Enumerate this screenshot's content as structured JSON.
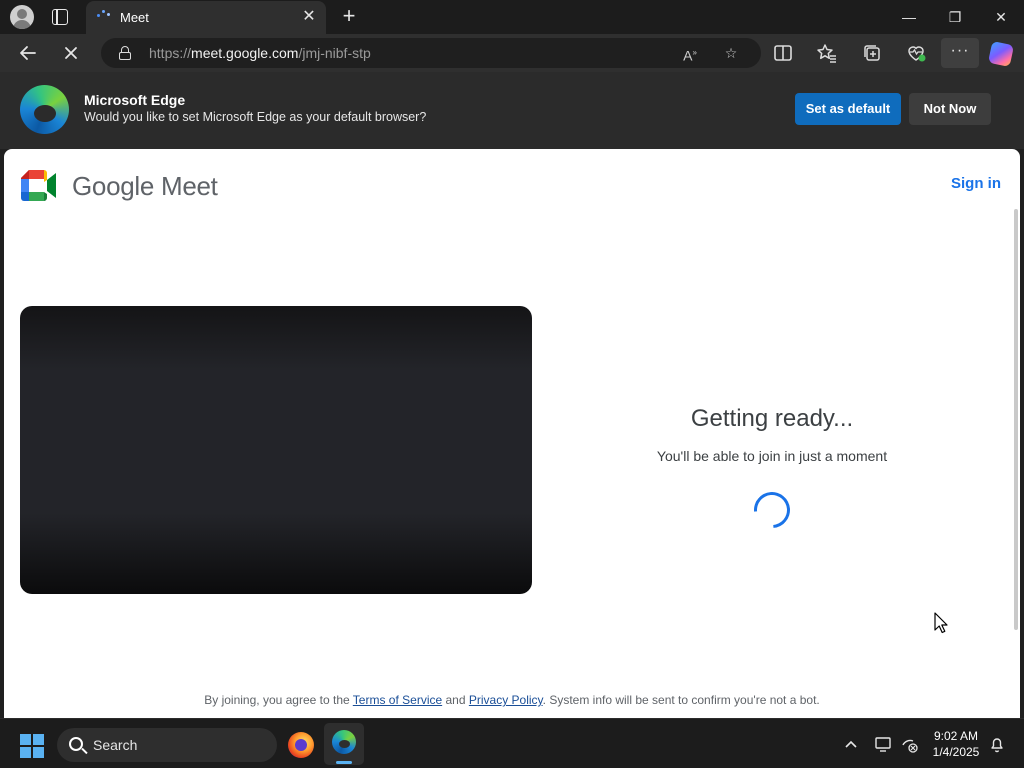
{
  "tab": {
    "title": "Meet"
  },
  "address_bar": {
    "url_scheme": "https://",
    "url_host": "meet.google.com",
    "url_path": "/jmj-nibf-stp"
  },
  "infobar": {
    "title": "Microsoft Edge",
    "message": "Would you like to set Microsoft Edge as your default browser?",
    "primary_button": "Set as default",
    "secondary_button": "Not Now"
  },
  "page": {
    "brand": "Google Meet",
    "sign_in": "Sign in",
    "status_title": "Getting ready...",
    "status_subtitle": "You'll be able to join in just a moment",
    "footer": {
      "prefix": "By joining, you agree to the ",
      "terms": "Terms of Service",
      "and": " and ",
      "privacy": "Privacy Policy",
      "suffix": ". System info will be sent to confirm you're not a bot."
    }
  },
  "taskbar": {
    "search_label": "Search",
    "time": "9:02 AM",
    "date": "1/4/2025"
  },
  "colors": {
    "accent": "#0f6cbd",
    "meet_link": "#1a73e8",
    "taskbar_accent": "#5ab2f2"
  }
}
